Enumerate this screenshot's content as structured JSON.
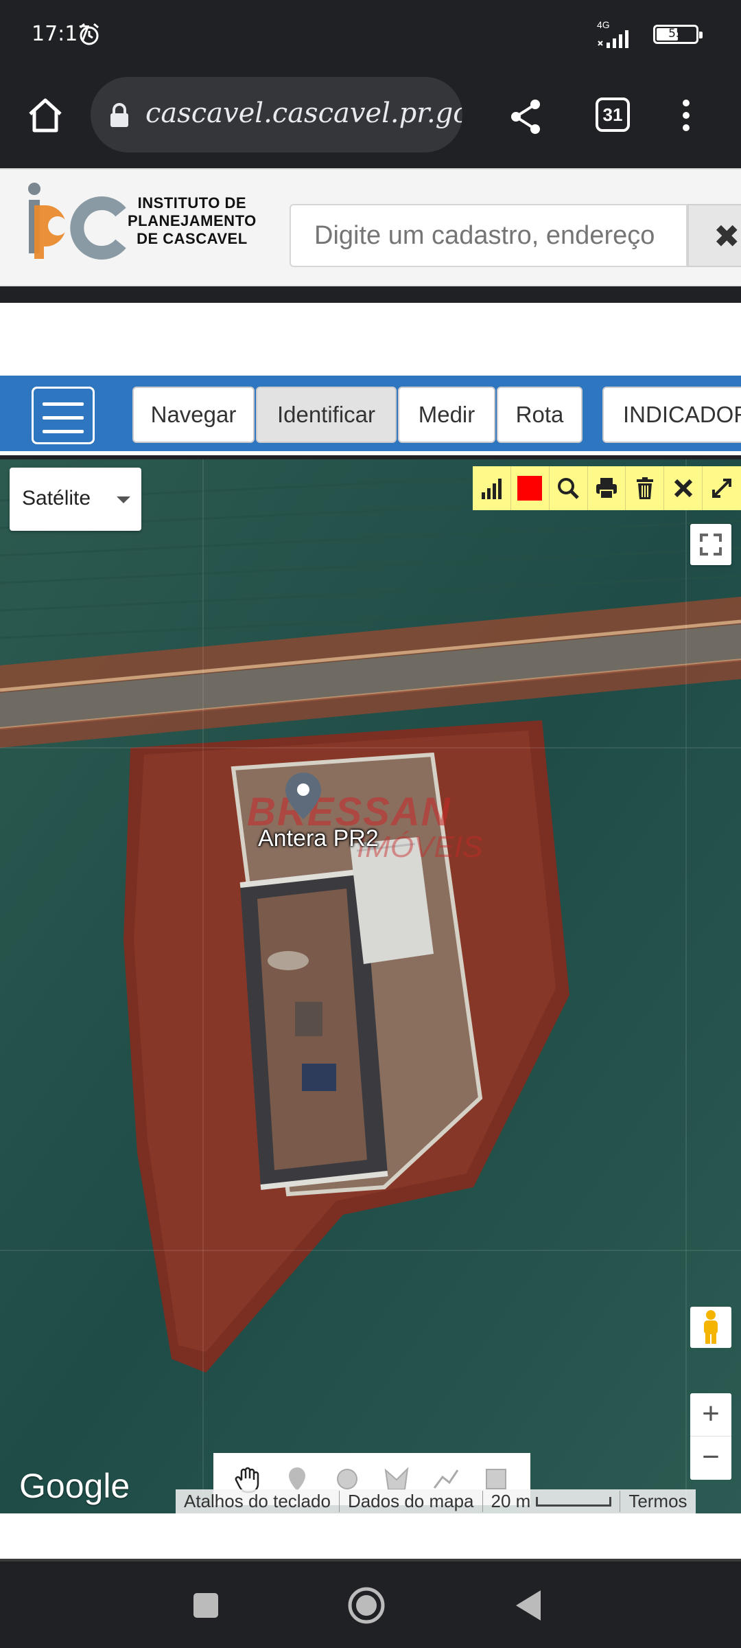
{
  "status_bar": {
    "time": "17:17",
    "network": "4G",
    "battery": "55",
    "battery_level": 0.55
  },
  "browser": {
    "url": "cascavel.cascavel.pr.gov.br",
    "tab_count": "31"
  },
  "header": {
    "logo_lines": [
      "INSTITUTO DE",
      "PLANEJAMENTO",
      "DE CASCAVEL"
    ],
    "search_placeholder": "Digite um cadastro, endereço",
    "clear_label": "✖"
  },
  "toolbar": {
    "buttons": [
      "Navegar",
      "Identificar",
      "Medir",
      "Rota",
      "INDICADOR"
    ],
    "active": "Identificar"
  },
  "map": {
    "layer_select": "Satélite",
    "marker_label": "Antera PR2",
    "watermark": "BRESSAN",
    "watermark2": "IMÓVEIS",
    "google_logo": "Google",
    "attribution": {
      "shortcuts": "Atalhos do teclado",
      "map_data": "Dados do mapa",
      "scale": "20 m",
      "terms": "Termos"
    },
    "tools_color_swatch": "#ff0000"
  },
  "colors": {
    "toolbar_bg": "#2f76c0",
    "tools_bg": "#fff98a",
    "system_bar": "#202124"
  }
}
